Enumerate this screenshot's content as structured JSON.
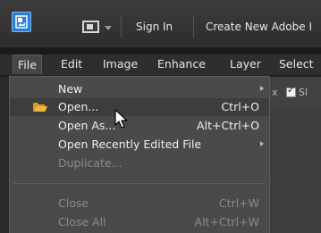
{
  "topbar": {
    "sign_in": "Sign In",
    "create_new": "Create New Adobe I"
  },
  "menubar": {
    "items": [
      "File",
      "Edit",
      "Image",
      "Enhance",
      "Layer",
      "Select"
    ]
  },
  "workspace": {
    "partial_text_left": "x",
    "partial_text_right": "Sl"
  },
  "file_menu": {
    "items": [
      {
        "label": "New",
        "shortcut": "",
        "submenu": true,
        "disabled": false
      },
      {
        "label": "Open...",
        "shortcut": "Ctrl+O",
        "submenu": false,
        "disabled": false,
        "icon": "folder-icon"
      },
      {
        "label": "Open As...",
        "shortcut": "Alt+Ctrl+O",
        "submenu": false,
        "disabled": false
      },
      {
        "label": "Open Recently Edited File",
        "shortcut": "",
        "submenu": true,
        "disabled": false
      },
      {
        "label": "Duplicate...",
        "shortcut": "",
        "submenu": false,
        "disabled": true
      },
      {
        "label": "Close",
        "shortcut": "Ctrl+W",
        "submenu": false,
        "disabled": true
      },
      {
        "label": "Close All",
        "shortcut": "Alt+Ctrl+W",
        "submenu": false,
        "disabled": true
      }
    ]
  },
  "colors": {
    "background": "#1a1a1a",
    "menu_bg": "#4a4a4a",
    "app_icon_blue": "#2a7fd4",
    "folder_yellow": "#f0b63a"
  }
}
